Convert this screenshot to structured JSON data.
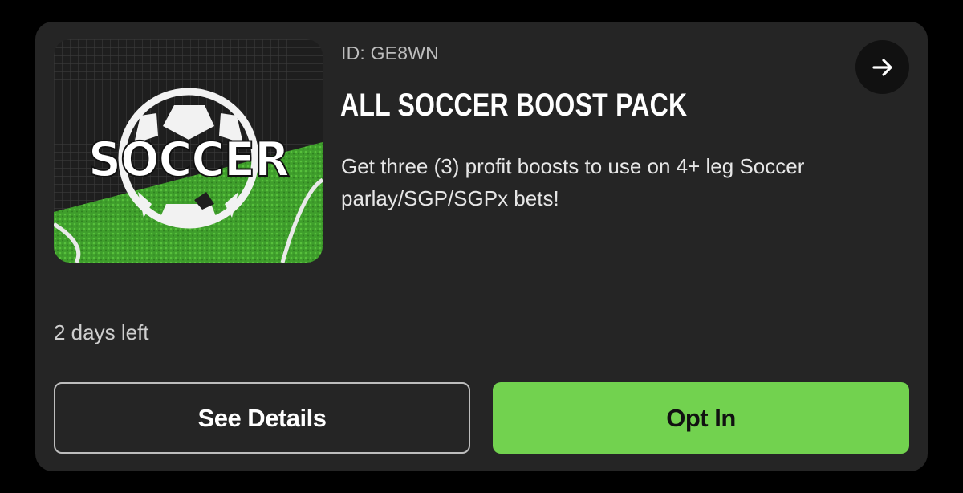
{
  "promo": {
    "image_text": "SOCCER",
    "id_label": "ID: GE8WN",
    "title": "ALL SOCCER BOOST PACK",
    "description": "Get three (3) profit boosts to use on 4+ leg Soccer parlay/SGP/SGPx bets!",
    "time_left": "2 days left",
    "see_details_label": "See Details",
    "opt_in_label": "Opt In",
    "arrow_icon": "arrow-right-icon"
  },
  "colors": {
    "page_background": "#000000",
    "card_background": "#252525",
    "primary_green": "#72d24f",
    "outline": "#bdbdbd"
  }
}
